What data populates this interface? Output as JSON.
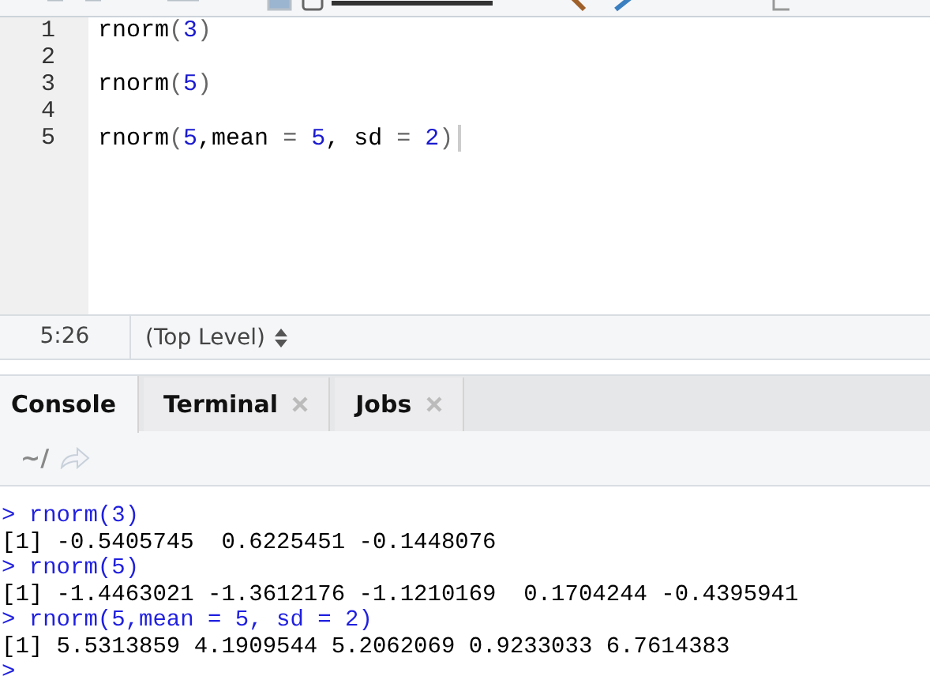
{
  "editor": {
    "lines": [
      {
        "number": "1",
        "tokens": [
          {
            "kind": "ident",
            "text": "rnorm"
          },
          {
            "kind": "punct",
            "text": "("
          },
          {
            "kind": "number",
            "text": "3"
          },
          {
            "kind": "punct",
            "text": ")"
          }
        ]
      },
      {
        "number": "2"
      },
      {
        "number": "3",
        "tokens": [
          {
            "kind": "ident",
            "text": "rnorm"
          },
          {
            "kind": "punct",
            "text": "("
          },
          {
            "kind": "number",
            "text": "5"
          },
          {
            "kind": "punct",
            "text": ")"
          }
        ]
      },
      {
        "number": "4"
      },
      {
        "number": "5",
        "tokens": [
          {
            "kind": "ident",
            "text": "rnorm"
          },
          {
            "kind": "punct",
            "text": "("
          },
          {
            "kind": "number",
            "text": "5"
          },
          {
            "kind": "ident",
            "text": ",mean"
          },
          {
            "kind": "punct",
            "text": " = "
          },
          {
            "kind": "number",
            "text": "5"
          },
          {
            "kind": "ident",
            "text": ", sd"
          },
          {
            "kind": "punct",
            "text": " = "
          },
          {
            "kind": "number",
            "text": "2"
          },
          {
            "kind": "punct",
            "text": ")"
          }
        ]
      }
    ]
  },
  "status_bar": {
    "position": "5:26",
    "scope": "(Top Level)"
  },
  "tabs": [
    {
      "label": "Console",
      "selected": true,
      "closable": false
    },
    {
      "label": "Terminal",
      "selected": false,
      "closable": true
    },
    {
      "label": "Jobs",
      "selected": false,
      "closable": true
    }
  ],
  "path": "~/",
  "console": [
    {
      "kind": "input",
      "prompt": ">",
      "text": "rnorm(3)"
    },
    {
      "kind": "output",
      "text": "[1] -0.5405745  0.6225451 -0.1448076"
    },
    {
      "kind": "input",
      "prompt": ">",
      "text": "rnorm(5)"
    },
    {
      "kind": "output",
      "text": "[1] -1.4463021 -1.3612176 -1.1210169  0.1704244 -0.4395941"
    },
    {
      "kind": "input",
      "prompt": ">",
      "text": "rnorm(5,mean = 5, sd = 2)"
    },
    {
      "kind": "output",
      "text": "[1] 5.5313859 4.1909544 5.2062069 0.9233033 6.7614383"
    },
    {
      "kind": "input",
      "prompt": ">"
    }
  ]
}
